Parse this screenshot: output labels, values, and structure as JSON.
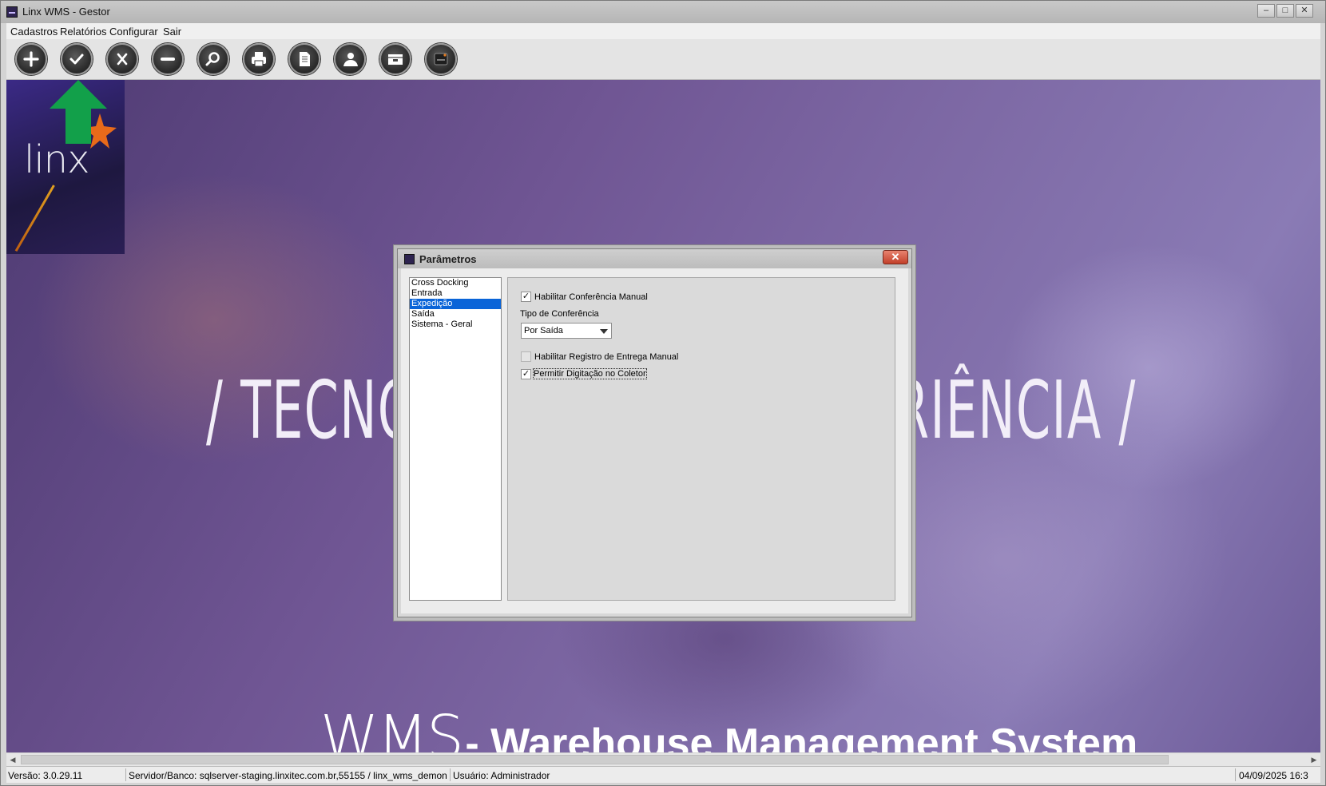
{
  "window": {
    "title": "Linx WMS - Gestor",
    "controls": {
      "minimize": "–",
      "maximize": "□",
      "close": "✕"
    }
  },
  "menubar": {
    "items": [
      "Cadastros",
      "Relatórios",
      "Configurar",
      "Sair"
    ]
  },
  "toolbar": {
    "buttons": [
      {
        "name": "add-button",
        "icon": "plus-icon"
      },
      {
        "name": "confirm-button",
        "icon": "check-icon"
      },
      {
        "name": "cancel-button",
        "icon": "x-icon"
      },
      {
        "name": "remove-button",
        "icon": "minus-icon"
      },
      {
        "name": "search-button",
        "icon": "magnifier-icon"
      },
      {
        "name": "print-button",
        "icon": "printer-icon"
      },
      {
        "name": "document-button",
        "icon": "document-icon"
      },
      {
        "name": "user-button",
        "icon": "user-icon"
      },
      {
        "name": "archive-button",
        "icon": "archive-icon"
      },
      {
        "name": "linx-button",
        "icon": "linx-icon"
      }
    ]
  },
  "background": {
    "logo": "linx",
    "slogan_left": "/ TECNO",
    "slogan_right": "RIÊNCIA /",
    "footer_big": "WMS",
    "footer_sub": "- Warehouse Management System"
  },
  "dialog": {
    "title": "Parâmetros",
    "close_label": "✕",
    "categories": [
      "Cross Docking",
      "Entrada",
      "Expedição",
      "Saída",
      "Sistema - Geral"
    ],
    "selected_category": "Expedição",
    "fields": {
      "habilitar_conferencia_manual": {
        "label": "Habilitar Conferência Manual",
        "checked": true
      },
      "tipo_conferencia": {
        "label": "Tipo de Conferência",
        "value": "Por Saída"
      },
      "habilitar_registro_entrega": {
        "label": "Habilitar Registro de Entrega Manual",
        "checked": false
      },
      "permitir_digitacao_coletor": {
        "label": "Permitir Digitação no Coletor",
        "checked": true
      }
    }
  },
  "status": {
    "version": "Versão: 3.0.29.11",
    "server": "Servidor/Banco: sqlserver-staging.linxitec.com.br,55155 / linx_wms_demon",
    "user": "Usuário: Administrador",
    "datetime": "04/09/2025 16:3"
  },
  "colors": {
    "selection": "#0a64d8",
    "accent_green": "#12a04a",
    "background_purple": "#6f5593"
  }
}
